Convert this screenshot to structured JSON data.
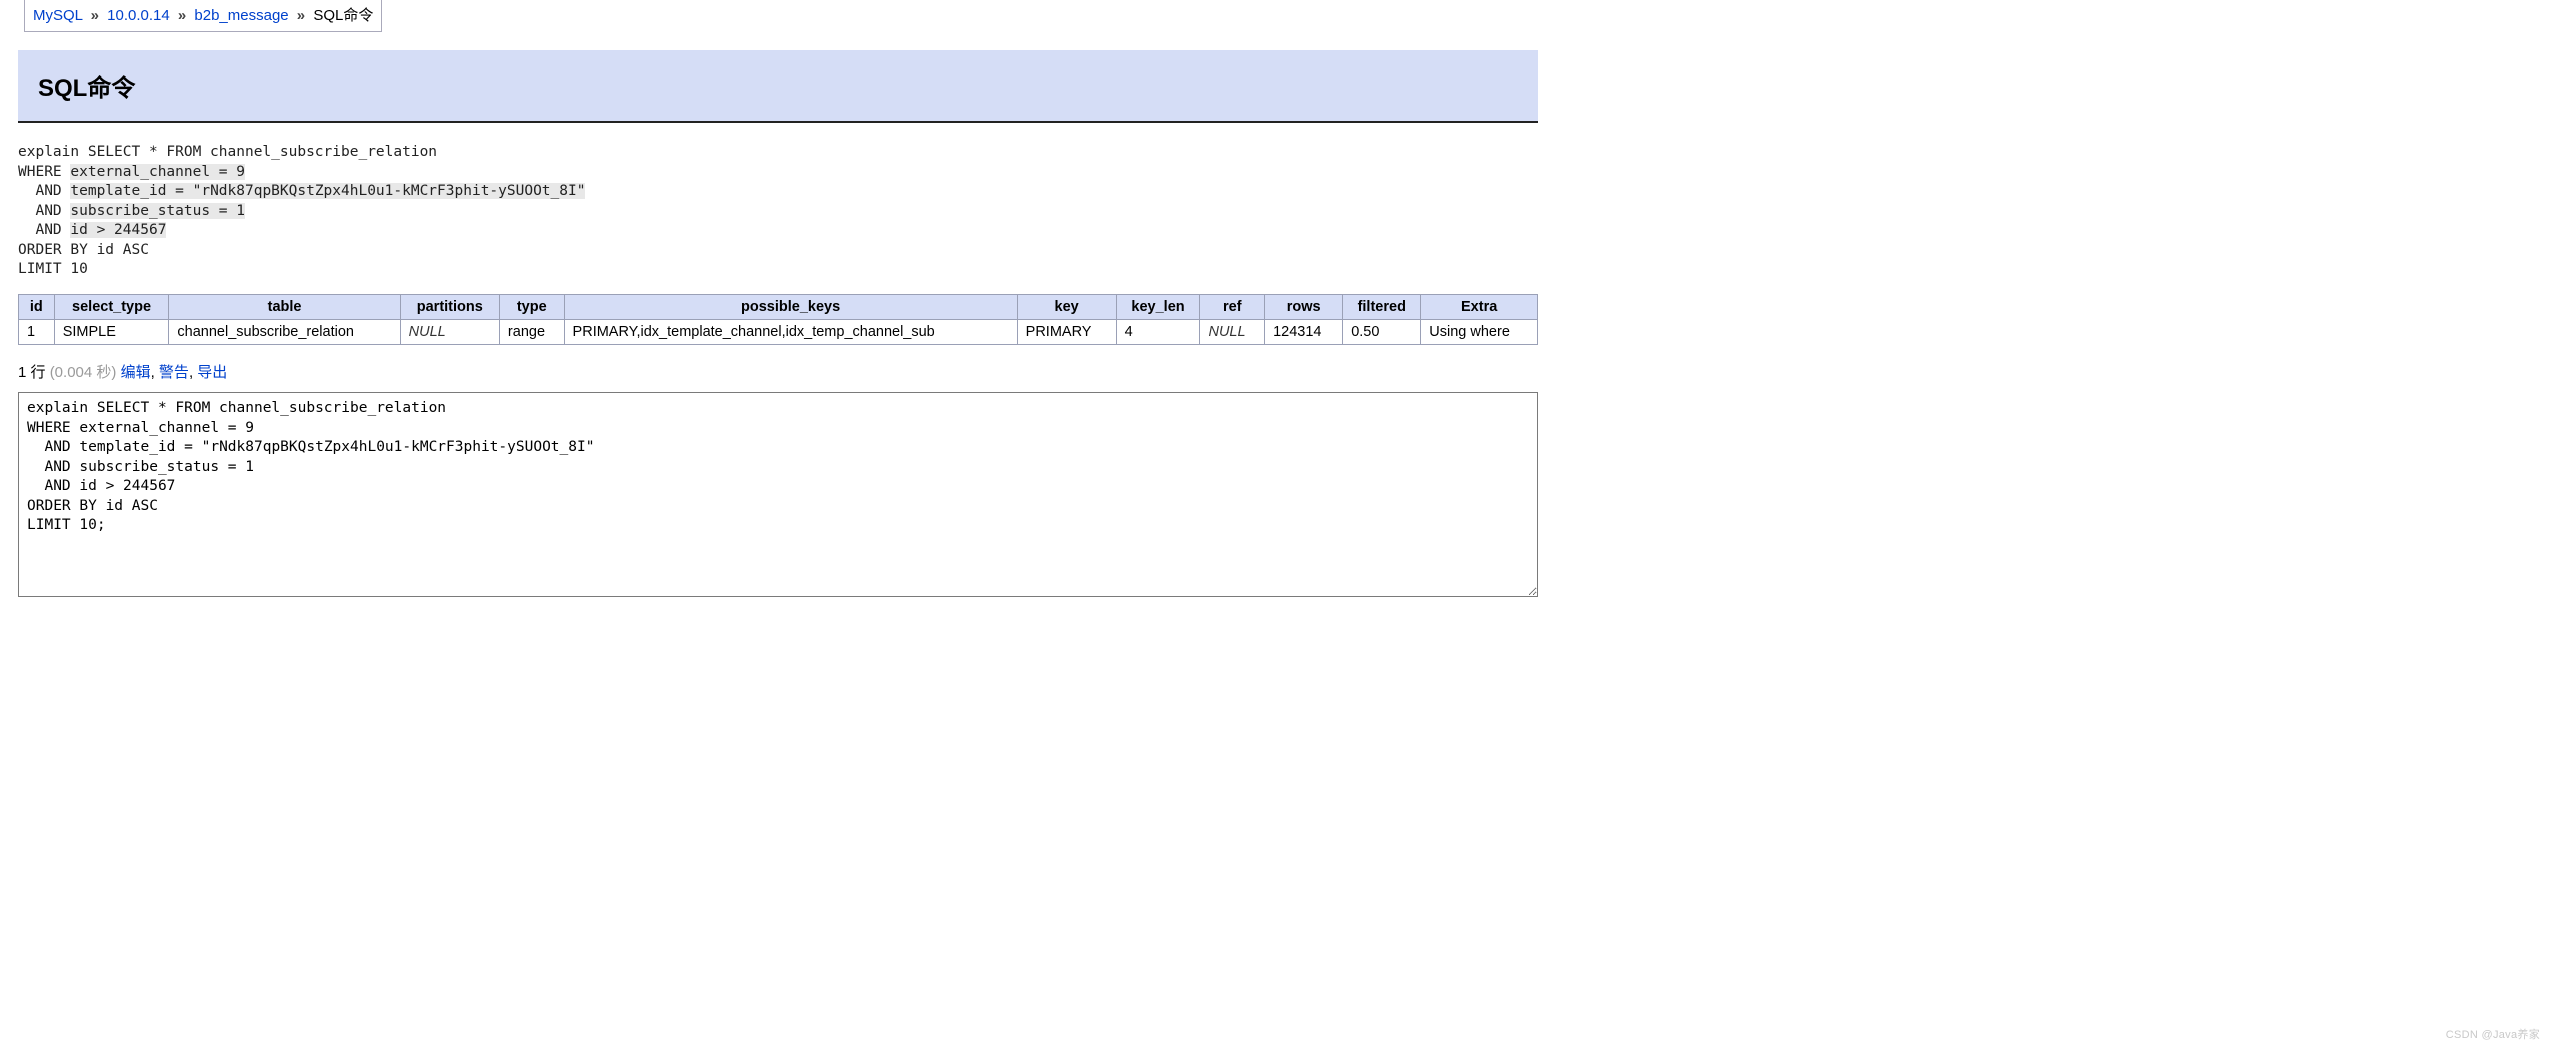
{
  "breadcrumb": {
    "items": [
      "MySQL",
      "10.0.0.14",
      "b2b_message",
      "SQL命令"
    ]
  },
  "panel": {
    "title": "SQL命令"
  },
  "sql_display": {
    "line1": "explain SELECT * FROM channel_subscribe_relation",
    "line2_pre": "WHERE ",
    "line2_hl": "external_channel = 9",
    "line3_pre": "  AND ",
    "line3_hl": "template_id = \"rNdk87qpBKQstZpx4hL0u1-kMCrF3phit-ySUOOt_8I\"",
    "line4_pre": "  AND ",
    "line4_hl": "subscribe_status = 1",
    "line5_pre": "  AND ",
    "line5_hl": "id > 244567",
    "line6": "ORDER BY id ASC",
    "line7": "LIMIT 10"
  },
  "explain_table": {
    "headers": [
      "id",
      "select_type",
      "table",
      "partitions",
      "type",
      "possible_keys",
      "key",
      "key_len",
      "ref",
      "rows",
      "filtered",
      "Extra"
    ],
    "row": {
      "id": "1",
      "select_type": "SIMPLE",
      "table": "channel_subscribe_relation",
      "partitions": "NULL",
      "type": "range",
      "possible_keys": "PRIMARY,idx_template_channel,idx_temp_channel_sub",
      "key": "PRIMARY",
      "key_len": "4",
      "ref": "NULL",
      "rows": "124314",
      "filtered": "0.50",
      "Extra": "Using where"
    }
  },
  "status": {
    "rows": "1 行",
    "timing": "(0.004 秒)",
    "edit": "编辑",
    "warn": "警告",
    "export": "导出"
  },
  "sql_input": "explain SELECT * FROM channel_subscribe_relation\nWHERE external_channel = 9\n  AND template_id = \"rNdk87qpBKQstZpx4hL0u1-kMCrF3phit-ySUOOt_8I\"\n  AND subscribe_status = 1\n  AND id > 244567\nORDER BY id ASC\nLIMIT 10;",
  "watermark": "CSDN @Java养家"
}
